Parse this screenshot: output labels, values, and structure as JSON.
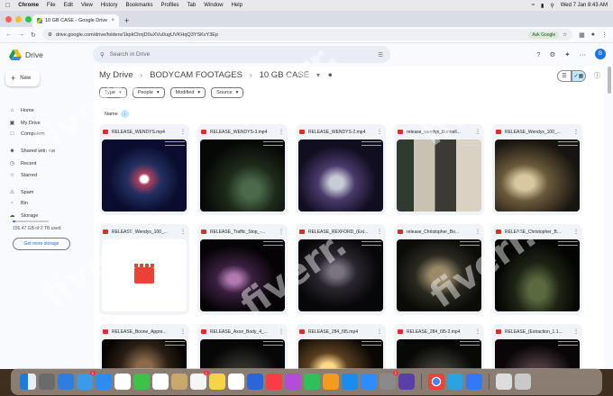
{
  "menubar": {
    "app": "Chrome",
    "items": [
      "File",
      "Edit",
      "View",
      "History",
      "Bookmarks",
      "Profiles",
      "Tab",
      "Window",
      "Help"
    ],
    "clock": "Wed 7 Jan  8:43 AM"
  },
  "browser": {
    "tab_title": "10 GB CASE - Google Drive",
    "url": "drive.google.com/drive/folders/1kpkChnjD0uXVu0ugUVKHqQ3YSKvY3Ep",
    "ask_google": "Ask Google"
  },
  "drive": {
    "brand": "Drive",
    "search_placeholder": "Search in Drive",
    "avatar_letter": "B",
    "new_label": "New",
    "nav": [
      {
        "label": "Home",
        "icon": "home-icon"
      },
      {
        "label": "My Drive",
        "icon": "drive-icon"
      },
      {
        "label": "Computers",
        "icon": "computer-icon"
      },
      {
        "label": "Shared with me",
        "icon": "people-icon"
      },
      {
        "label": "Recent",
        "icon": "clock-icon"
      },
      {
        "label": "Starred",
        "icon": "star-icon"
      },
      {
        "label": "Spam",
        "icon": "spam-icon"
      },
      {
        "label": "Bin",
        "icon": "trash-icon"
      },
      {
        "label": "Storage",
        "icon": "cloud-icon"
      }
    ],
    "storage_text": "156.47 GB of 2 TB used",
    "storage_fraction": 0.08,
    "get_more": "Get more storage",
    "breadcrumbs": [
      "My Drive",
      "BODYCAM FOOTAGES",
      "10 GB CASE"
    ],
    "filters": [
      "Type",
      "People",
      "Modified",
      "Source"
    ],
    "sort_label": "Name",
    "files": [
      "RELEASE_WENDYS.mp4",
      "RELEASE_WENDYS-3.mp4",
      "RELEASE_WENDYS-2.mp4",
      "release_wendys_Bunnell...",
      "RELEASE_Wendys_100_...",
      "RELEASE_Wendys_100_...",
      "RELEASE_Traffic_Stop_-...",
      "RELEASE_REXFORD_(Ext...",
      "release_Christopher_Bo...",
      "RELEASE_Christopher_B...",
      "RELEASE_Boone_Appre...",
      "RELEASE_Axon_Body_4_...",
      "RELEASE_284_I95.mp4",
      "RELEASE_284_I95-2.mp4",
      "RELEASE_(Extraction_1.1..."
    ]
  },
  "watermark": "fiverr."
}
